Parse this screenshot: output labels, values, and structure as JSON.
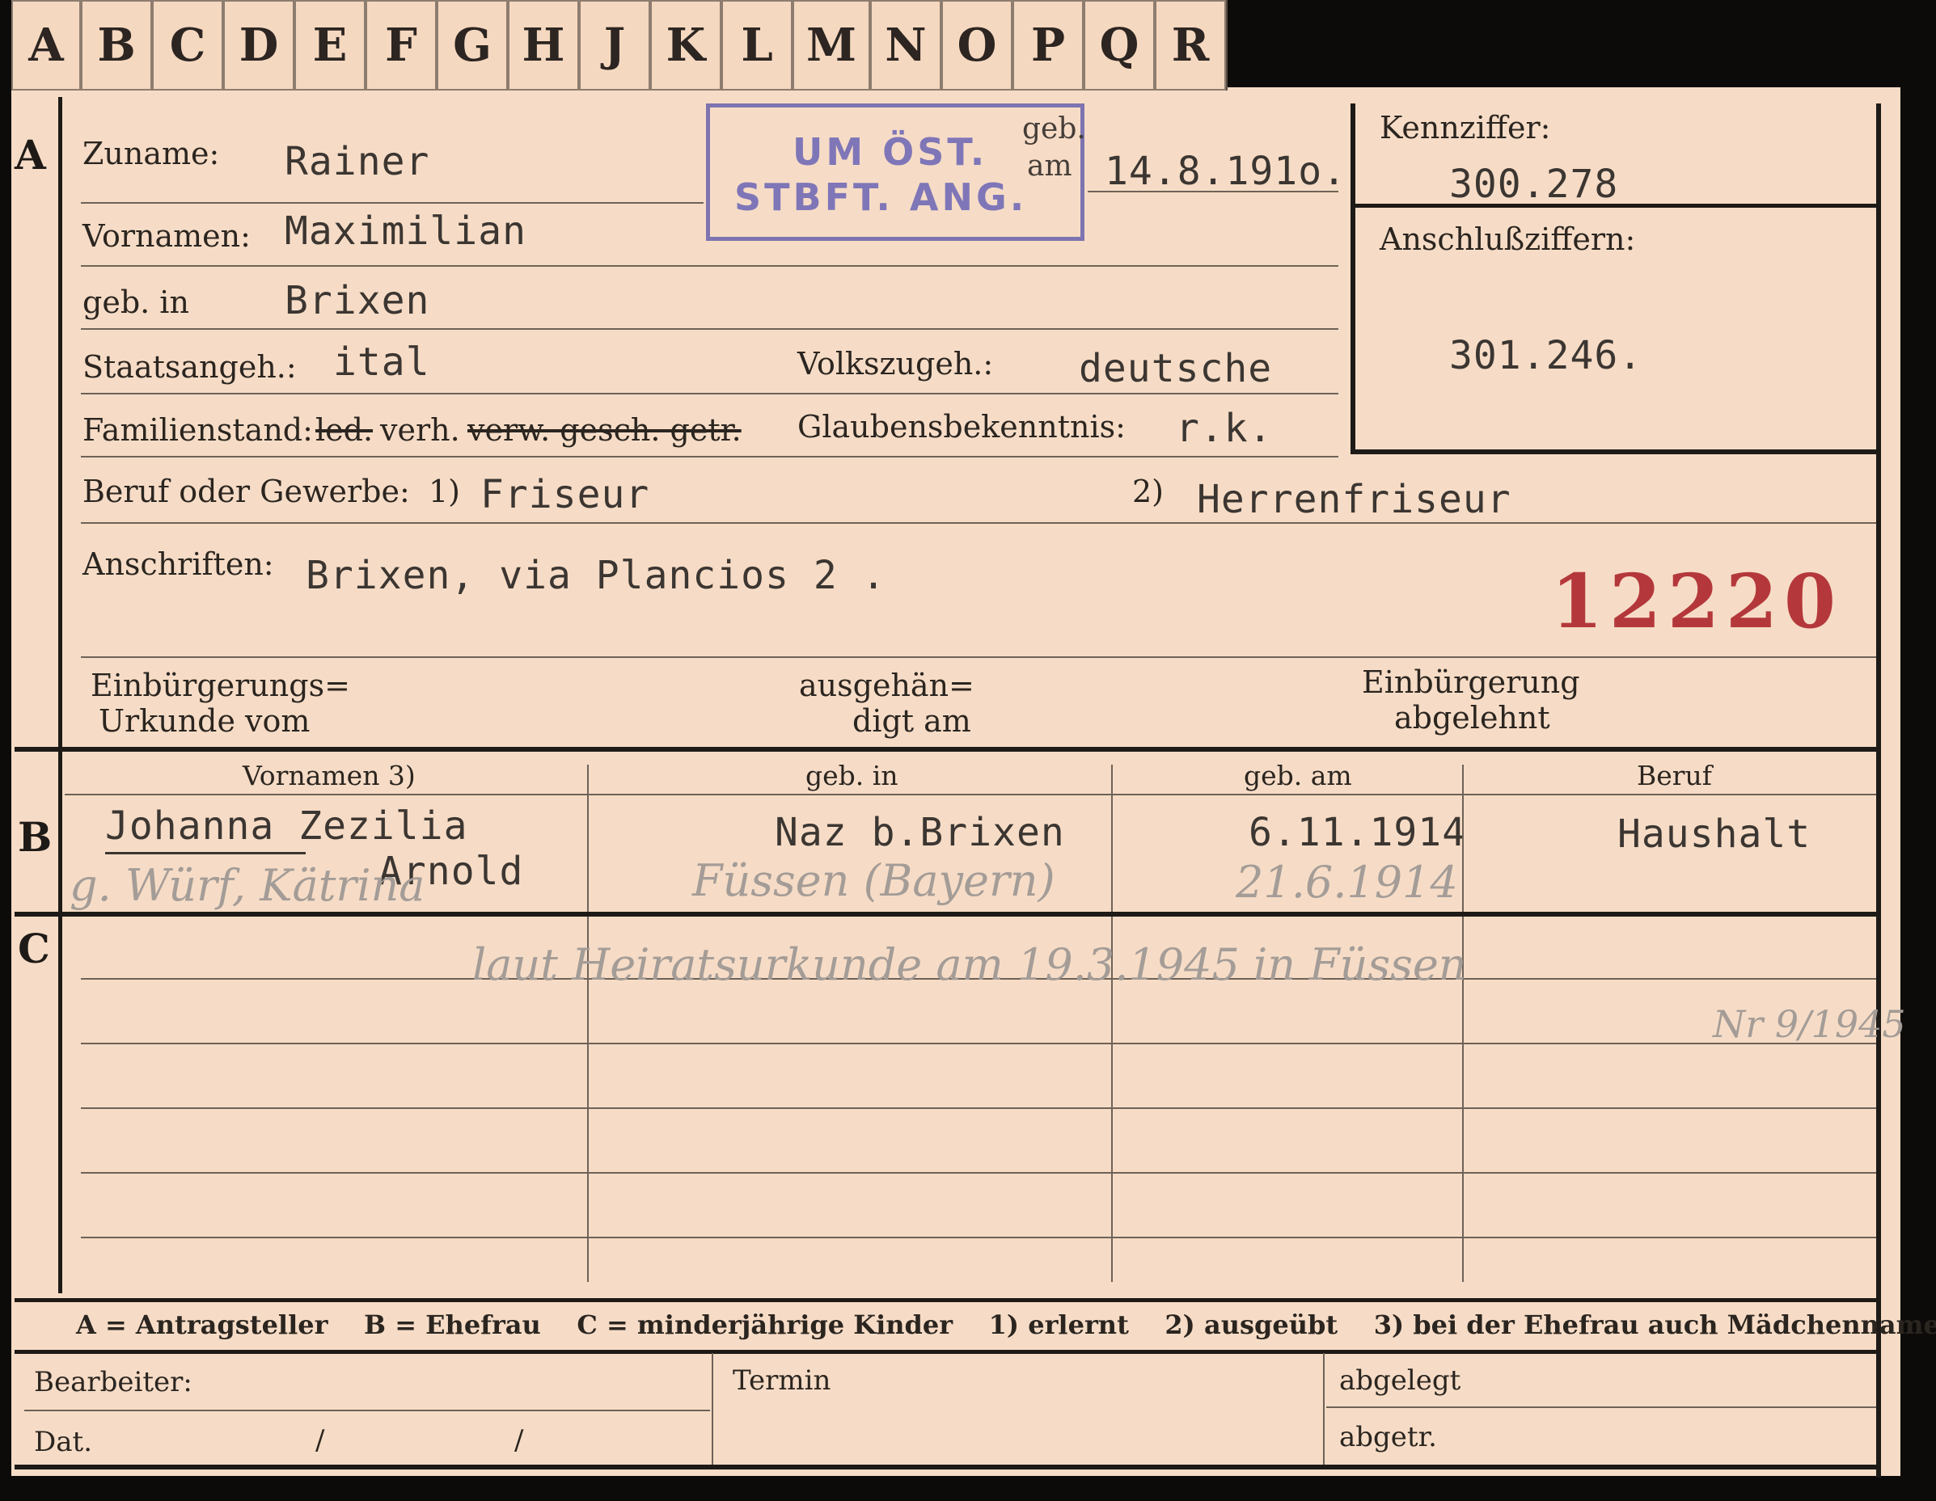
{
  "tabs": [
    "A",
    "B",
    "C",
    "D",
    "E",
    "F",
    "G",
    "H",
    "J",
    "K",
    "L",
    "M",
    "N",
    "O",
    "P",
    "Q",
    "R"
  ],
  "section_a": {
    "marker": "A",
    "zuname_label": "Zuname:",
    "zuname_value": "Rainer",
    "stamp_line1": "UM ÖST.",
    "stamp_line2": "STBFT. ANG.",
    "geb_label1": "geb.",
    "geb_label2": "am",
    "geb_value": "14.8.191o.",
    "vornamen_label": "Vornamen:",
    "vornamen_value": "Maximilian",
    "gebin_label": "geb. in",
    "gebin_value": "Brixen",
    "staats_label": "Staatsangeh.:",
    "staats_value": "ital",
    "volks_label": "Volkszugeh.:",
    "volks_value": "deutsche",
    "familien_label": "Familienstand:",
    "familien_struck1": "led.",
    "familien_value": "verh.",
    "familien_struck2": "verw. gesch. getr.",
    "glauben_label": "Glaubensbekenntnis:",
    "glauben_value": "r.k.",
    "beruf_label": "Beruf oder Gewerbe:",
    "beruf_mark1": "1)",
    "beruf_value1": "Friseur",
    "beruf_mark2": "2)",
    "beruf_value2": "Herrenfriseur",
    "anschr_label": "Anschriften:",
    "anschr_value": "Brixen, via Plancios 2 .",
    "file_number": "12220",
    "einb_label_l1": "Einbürgerungs=",
    "einb_label_l2": "Urkunde vom",
    "ausg_label_l1": "ausgehän=",
    "ausg_label_l2": "digt am",
    "abgel_label_l1": "Einbürgerung",
    "abgel_label_l2": "abgelehnt",
    "kennziffer_label": "Kennziffer:",
    "kennziffer_value": "300.278",
    "anschluss_label": "Anschlußziffern:",
    "anschluss_value": "301.246."
  },
  "section_b": {
    "marker": "B",
    "col_vornamen": "Vornamen 3)",
    "col_gebin": "geb. in",
    "col_gebam": "geb. am",
    "col_beruf": "Beruf",
    "row_vornamen": "Johanna Zezilia",
    "row_vornamen2": "Arnold",
    "row_gebin": "Naz b.Brixen",
    "row_gebam": "6.11.1914",
    "row_beruf": "Haushalt",
    "hand_name": "g. Würf, Kätrina",
    "hand_place": "Füssen (Bayern)",
    "hand_date": "21.6.1914"
  },
  "section_c": {
    "marker": "C",
    "hand_note": "laut Heiratsurkunde am 19.3.1945 in Füssen",
    "hand_ref": "Nr 9/1945"
  },
  "legend": "A = Antragsteller    B = Ehefrau    C = minderjährige Kinder    1) erlernt    2) ausgeübt    3) bei der Ehefrau auch Mädchenname",
  "footer": {
    "bearbeiter_label": "Bearbeiter:",
    "dat_label": "Dat.",
    "dat_sep1": "/",
    "dat_sep2": "/",
    "termin_label": "Termin",
    "abgelegt_label": "abgelegt",
    "abgetr_label": "abgetr."
  },
  "colors": {
    "card": "#f6dcc6",
    "stamp": "#7f76b8",
    "number": "#b4383b"
  }
}
